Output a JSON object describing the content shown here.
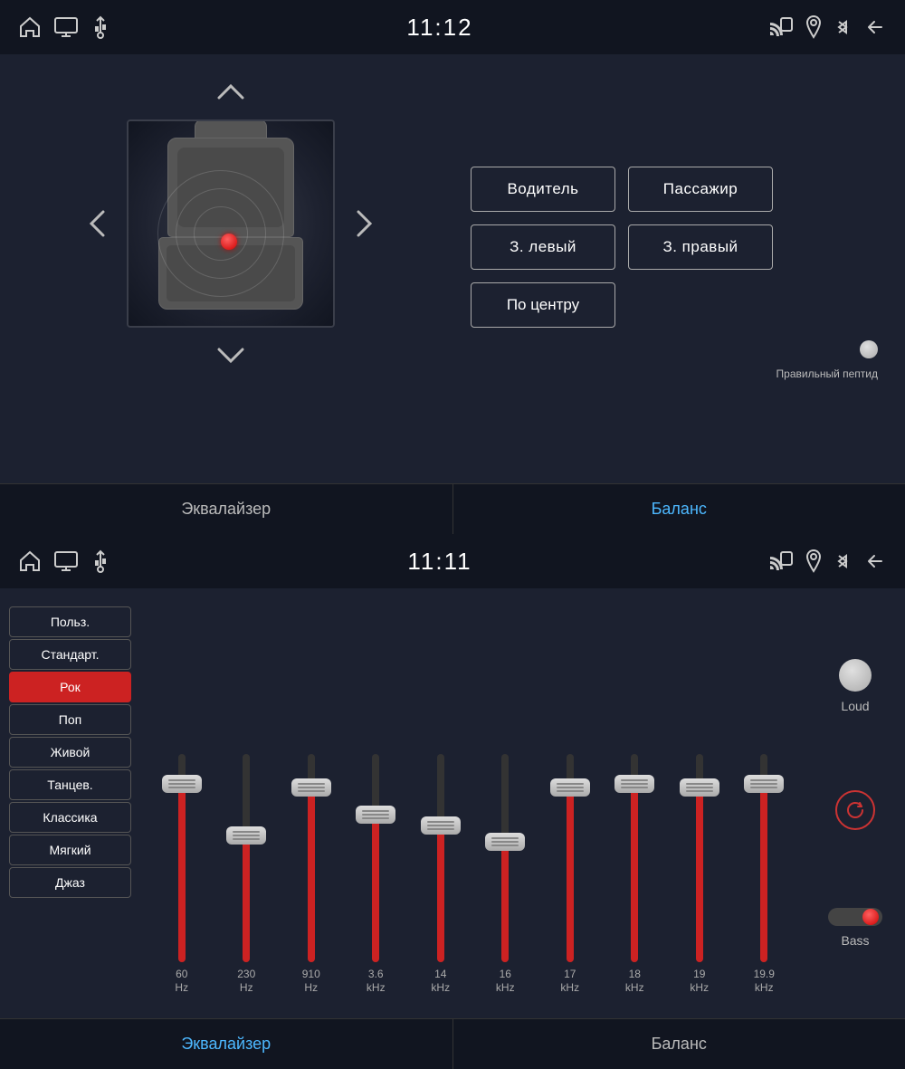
{
  "top": {
    "statusBar": {
      "time": "11:12",
      "leftIcons": [
        "home-icon",
        "screen-icon",
        "usb-icon"
      ],
      "rightIcons": [
        "cast-icon",
        "location-icon",
        "bluetooth-icon",
        "back-icon"
      ]
    },
    "seatButtons": {
      "driver": "Водитель",
      "passenger": "Пассажир",
      "rearLeft": "З. левый",
      "rearRight": "З. правый",
      "center": "По центру",
      "indicatorLabel": "Правильный пептид"
    },
    "tabs": [
      {
        "label": "Эквалайзер",
        "active": false
      },
      {
        "label": "Баланс",
        "active": true
      }
    ]
  },
  "bottom": {
    "statusBar": {
      "time": "11:11",
      "leftIcons": [
        "home-icon",
        "screen-icon",
        "usb-icon"
      ],
      "rightIcons": [
        "cast-icon",
        "location-icon",
        "bluetooth-icon",
        "back-icon"
      ]
    },
    "presets": [
      {
        "label": "Польз.",
        "active": false
      },
      {
        "label": "Стандарт.",
        "active": false
      },
      {
        "label": "Рок",
        "active": true
      },
      {
        "label": "Поп",
        "active": false
      },
      {
        "label": "Живой",
        "active": false
      },
      {
        "label": "Танцев.",
        "active": false
      },
      {
        "label": "Классика",
        "active": false
      },
      {
        "label": "Мягкий",
        "active": false
      },
      {
        "label": "Джаз",
        "active": false
      }
    ],
    "sliders": [
      {
        "freq": "60",
        "unit": "Hz",
        "fillPct": 90,
        "thumbPct": 10
      },
      {
        "freq": "230",
        "unit": "Hz",
        "fillPct": 65,
        "thumbPct": 35
      },
      {
        "freq": "910",
        "unit": "Hz",
        "fillPct": 88,
        "thumbPct": 12
      },
      {
        "freq": "3.6",
        "unit": "kHz",
        "fillPct": 75,
        "thumbPct": 25
      },
      {
        "freq": "14",
        "unit": "kHz",
        "fillPct": 70,
        "thumbPct": 30
      },
      {
        "freq": "16",
        "unit": "kHz",
        "fillPct": 62,
        "thumbPct": 38
      },
      {
        "freq": "17",
        "unit": "kHz",
        "fillPct": 88,
        "thumbPct": 12
      },
      {
        "freq": "18",
        "unit": "kHz",
        "fillPct": 90,
        "thumbPct": 10
      },
      {
        "freq": "19",
        "unit": "kHz",
        "fillPct": 88,
        "thumbPct": 12
      },
      {
        "freq": "19.9",
        "unit": "kHz",
        "fillPct": 90,
        "thumbPct": 10
      }
    ],
    "loudLabel": "Loud",
    "bassLabel": "Bass",
    "tabs": [
      {
        "label": "Эквалайзер",
        "active": true
      },
      {
        "label": "Баланс",
        "active": false
      }
    ]
  }
}
